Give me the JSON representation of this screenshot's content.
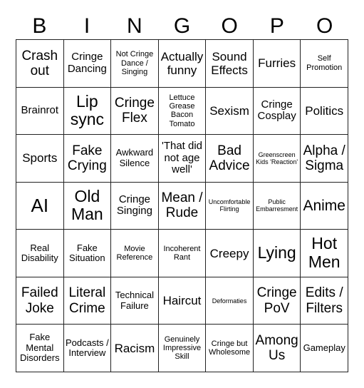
{
  "header": [
    "B",
    "I",
    "N",
    "G",
    "O",
    "P",
    "O"
  ],
  "cells": [
    [
      "Crash out",
      "Cringe Dancing",
      "Not Cringe Dance / Singing",
      "Actually funny",
      "Sound Effects",
      "Furries",
      "Self Promotion"
    ],
    [
      "Brainrot",
      "Lip sync",
      "Cringe Flex",
      "Lettuce Grease Bacon Tomato",
      "Sexism",
      "Cringe Cosplay",
      "Politics"
    ],
    [
      "Sports",
      "Fake Crying",
      "Awkward Silence",
      "'That did not age well'",
      "Bad Advice",
      "Greenscreen Kids 'Reaction'",
      "Alpha / Sigma"
    ],
    [
      "AI",
      "Old Man",
      "Cringe Singing",
      "Mean / Rude",
      "Uncomfortable Flirting",
      "Public Embarresment",
      "Anime"
    ],
    [
      "Real Disability",
      "Fake Situation",
      "Movie Reference",
      "Incoherent Rant",
      "Creepy",
      "Lying",
      "Hot Men"
    ],
    [
      "Failed Joke",
      "Literal Crime",
      "Technical Failure",
      "Haircut",
      "Deformaties",
      "Cringe PoV",
      "Edits / Filters"
    ],
    [
      "Fake Mental Disorders",
      "Podcasts / Interview",
      "Racism",
      "Genuinely Impressive Skill",
      "Cringe but Wholesome",
      "Among Us",
      "Gameplay"
    ]
  ]
}
